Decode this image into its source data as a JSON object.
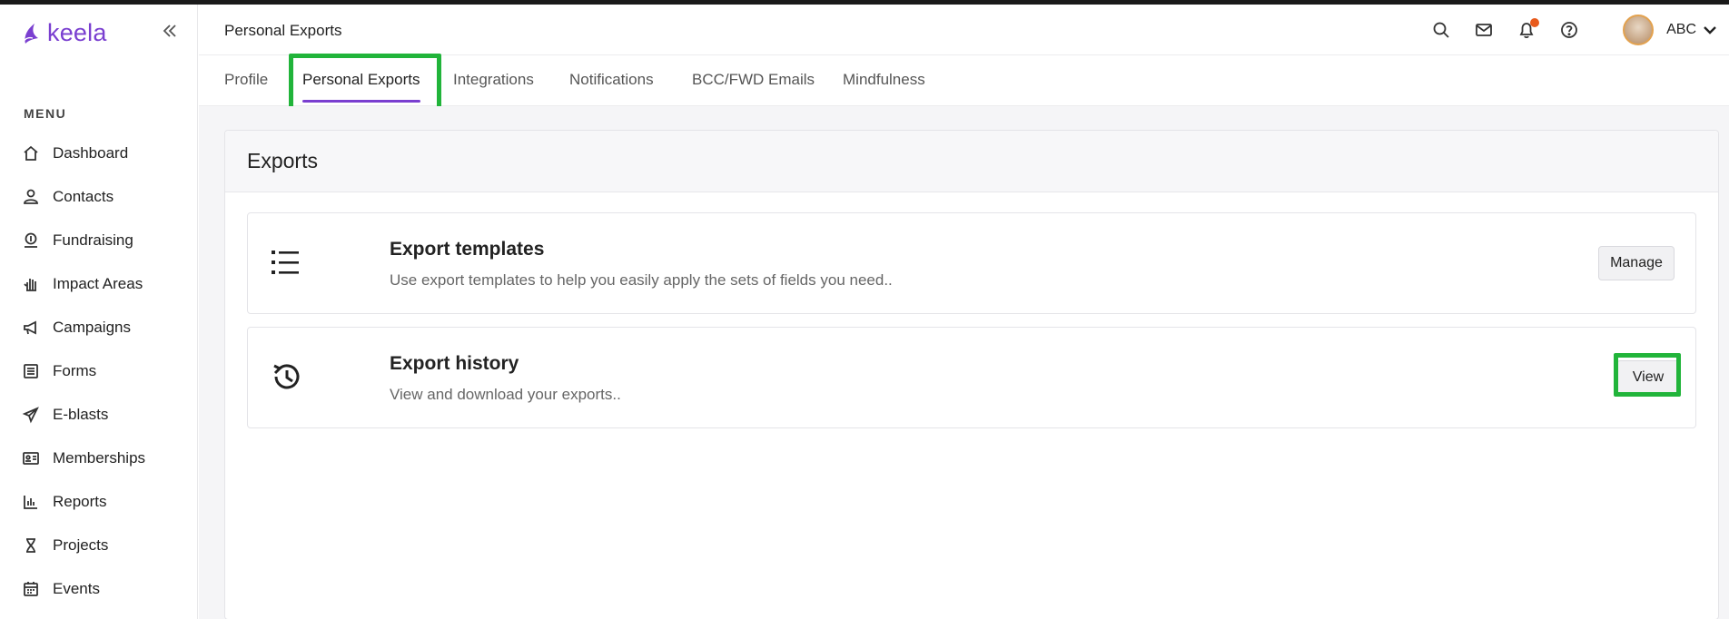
{
  "app": {
    "logo_text": "keela",
    "brand_color": "#7a3fd0",
    "highlight_color": "#21b43a"
  },
  "sidebar": {
    "collapse_icon": "double-chevron-left-icon",
    "menu_title": "MENU",
    "items": [
      {
        "label": "Dashboard",
        "icon": "home-icon"
      },
      {
        "label": "Contacts",
        "icon": "user-icon"
      },
      {
        "label": "Fundraising",
        "icon": "donation-icon"
      },
      {
        "label": "Impact Areas",
        "icon": "hand-icon"
      },
      {
        "label": "Campaigns",
        "icon": "megaphone-icon"
      },
      {
        "label": "Forms",
        "icon": "form-icon"
      },
      {
        "label": "E-blasts",
        "icon": "paper-plane-icon"
      },
      {
        "label": "Memberships",
        "icon": "id-card-icon"
      },
      {
        "label": "Reports",
        "icon": "bar-chart-icon"
      },
      {
        "label": "Projects",
        "icon": "hourglass-icon"
      },
      {
        "label": "Events",
        "icon": "calendar-icon"
      }
    ]
  },
  "header": {
    "title": "Personal Exports",
    "icons": [
      "search-icon",
      "mail-icon",
      "bell-icon",
      "help-icon"
    ],
    "notification_dot_color": "#e85a1c",
    "user_name": "ABC"
  },
  "tabs": [
    {
      "label": "Profile",
      "active": false
    },
    {
      "label": "Personal Exports",
      "active": true
    },
    {
      "label": "Integrations",
      "active": false
    },
    {
      "label": "Notifications",
      "active": false
    },
    {
      "label": "BCC/FWD Emails",
      "active": false
    },
    {
      "label": "Mindfulness",
      "active": false
    }
  ],
  "main": {
    "panel_title": "Exports",
    "cards": [
      {
        "title": "Export templates",
        "description": "Use export templates to help you easily apply the sets of fields you need..",
        "button": "Manage",
        "icon": "list-icon"
      },
      {
        "title": "Export history",
        "description": "View and download your exports..",
        "button": "View",
        "icon": "history-icon"
      }
    ]
  }
}
